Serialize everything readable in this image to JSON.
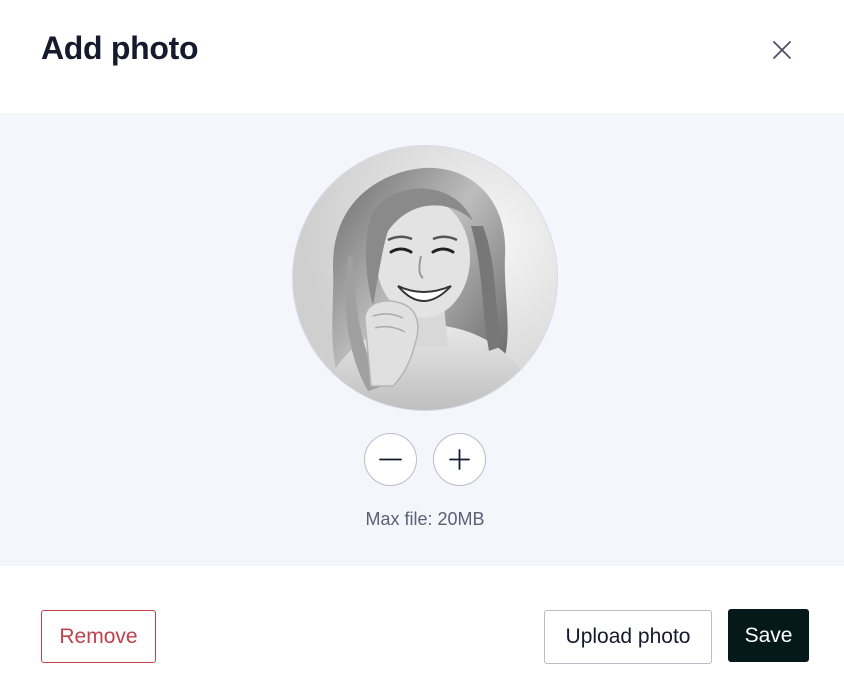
{
  "dialog": {
    "title": "Add photo",
    "close_icon": "close-icon"
  },
  "photo": {
    "icon": "avatar-photo",
    "zoom_out_icon": "minus-icon",
    "zoom_in_icon": "plus-icon",
    "max_file_text": "Max file: 20MB"
  },
  "footer": {
    "remove_label": "Remove",
    "upload_label": "Upload photo",
    "save_label": "Save"
  },
  "colors": {
    "title": "#151a2c",
    "remove": "#c0424a",
    "save_bg": "#06191a",
    "body_bg": "#f4f6fc",
    "muted_text": "#5a6175"
  }
}
